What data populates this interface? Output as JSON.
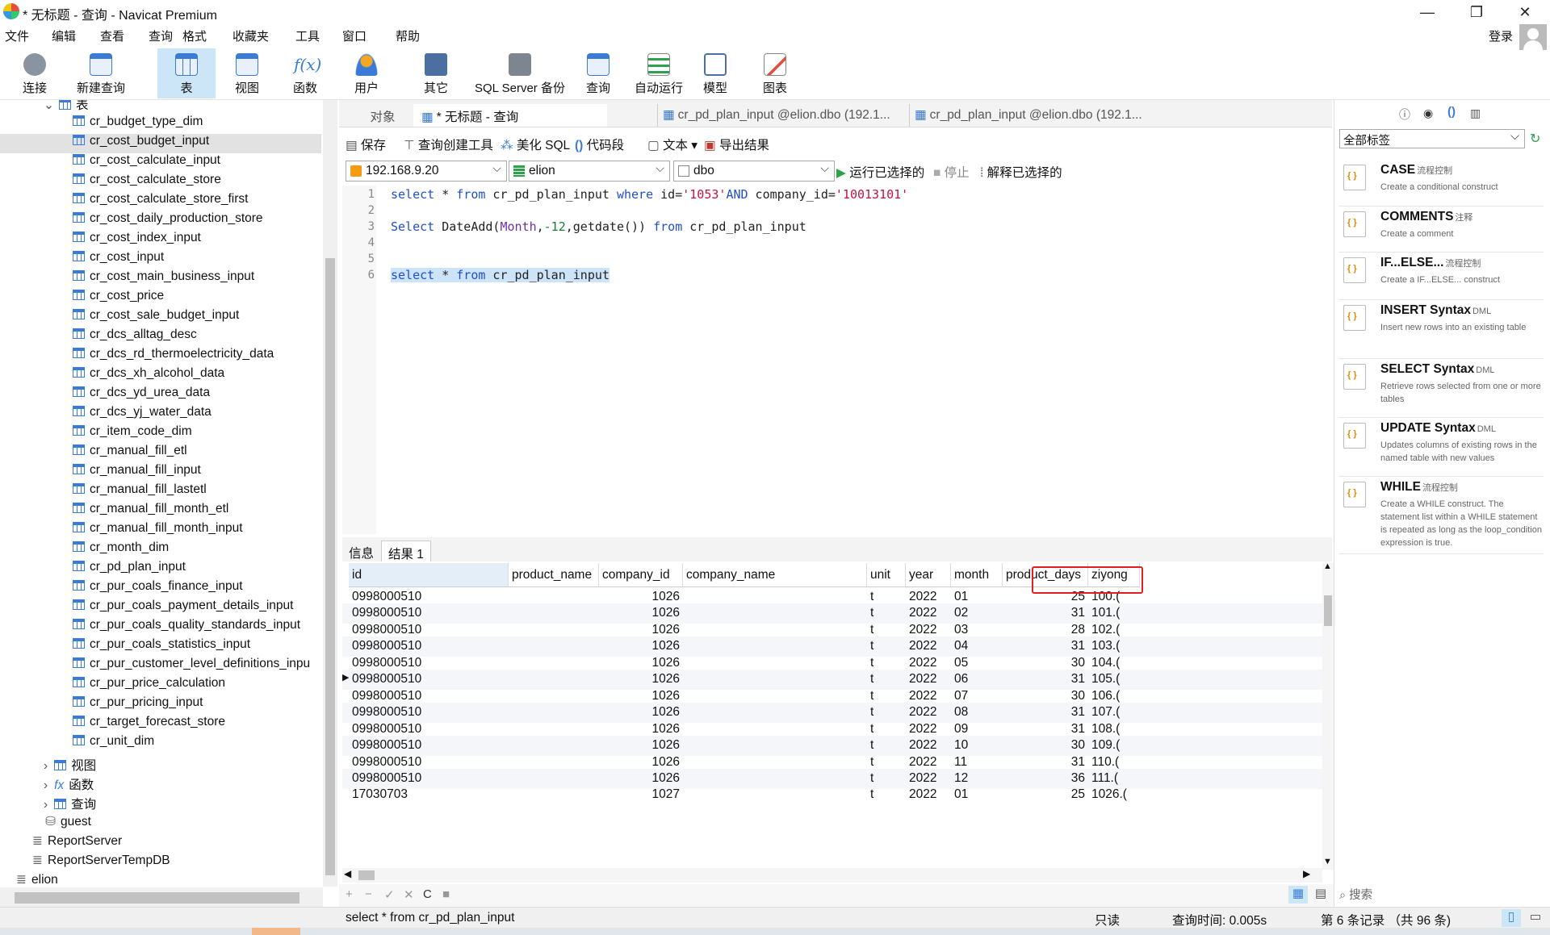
{
  "window": {
    "title": "* 无标题 - 查询 - Navicat Premium"
  },
  "menu": [
    "文件",
    "编辑",
    "查看",
    "查询",
    "格式",
    "收藏夹",
    "工具",
    "窗口",
    "帮助"
  ],
  "login_label": "登录",
  "toolbar": [
    {
      "label": "连接",
      "icon": "connect-icon"
    },
    {
      "label": "新建查询",
      "icon": "new-query-icon"
    },
    {
      "label": "表",
      "icon": "table-icon",
      "active": true
    },
    {
      "label": "视图",
      "icon": "view-icon"
    },
    {
      "label": "函数",
      "icon": "function-icon"
    },
    {
      "label": "用户",
      "icon": "user-icon"
    },
    {
      "label": "其它",
      "icon": "tools-icon"
    },
    {
      "label": "SQL Server 备份",
      "icon": "backup-icon"
    },
    {
      "label": "查询",
      "icon": "query-icon"
    },
    {
      "label": "自动运行",
      "icon": "schedule-icon"
    },
    {
      "label": "模型",
      "icon": "model-icon"
    },
    {
      "label": "图表",
      "icon": "chart-icon"
    }
  ],
  "tree": {
    "tables_label": "表",
    "tables": [
      "cr_budget_type_dim",
      "cr_cost_budget_input",
      "cr_cost_calculate_input",
      "cr_cost_calculate_store",
      "cr_cost_calculate_store_first",
      "cr_cost_daily_production_store",
      "cr_cost_index_input",
      "cr_cost_input",
      "cr_cost_main_business_input",
      "cr_cost_price",
      "cr_cost_sale_budget_input",
      "cr_dcs_alltag_desc",
      "cr_dcs_rd_thermoelectricity_data",
      "cr_dcs_xh_alcohol_data",
      "cr_dcs_yd_urea_data",
      "cr_dcs_yj_water_data",
      "cr_item_code_dim",
      "cr_manual_fill_etl",
      "cr_manual_fill_input",
      "cr_manual_fill_lastetl",
      "cr_manual_fill_month_etl",
      "cr_manual_fill_month_input",
      "cr_month_dim",
      "cr_pd_plan_input",
      "cr_pur_coals_finance_input",
      "cr_pur_coals_payment_details_input",
      "cr_pur_coals_quality_standards_input",
      "cr_pur_coals_statistics_input",
      "cr_pur_customer_level_definitions_inpu",
      "cr_pur_price_calculation",
      "cr_pur_pricing_input",
      "cr_target_forecast_store",
      "cr_unit_dim"
    ],
    "selected_index": 1,
    "groups": [
      "视图",
      "函数",
      "查询"
    ],
    "schema": "guest",
    "databases": [
      "ReportServer",
      "ReportServerTempDB",
      "elion"
    ]
  },
  "tabs": {
    "object": "对象",
    "query": "* 无标题 - 查询",
    "table1": "cr_pd_plan_input @elion.dbo (192.1...",
    "table2": "cr_pd_plan_input @elion.dbo (192.1..."
  },
  "query_tools": {
    "save": "保存",
    "builder": "查询创建工具",
    "beautify": "美化 SQL",
    "snippet": "代码段",
    "text": "文本",
    "export": "导出结果"
  },
  "connection": {
    "server": "192.168.9.20",
    "database": "elion",
    "schema": "dbo",
    "run_selected": "运行已选择的",
    "stop": "停止",
    "explain": "解释已选择的"
  },
  "editor": {
    "line_numbers": [
      "1",
      "2",
      "3",
      "4",
      "5",
      "6"
    ],
    "lines": [
      [
        [
          "kw",
          "select"
        ],
        [
          "t",
          " * "
        ],
        [
          "kw",
          "from"
        ],
        [
          "t",
          " cr_pd_plan_input "
        ],
        [
          "kw",
          "where"
        ],
        [
          "t",
          " id="
        ],
        [
          "str",
          "'1053'"
        ],
        [
          "kw",
          "AND"
        ],
        [
          "t",
          " company_id="
        ],
        [
          "str",
          "'10013101'"
        ]
      ],
      [],
      [
        [
          "kw",
          "Select"
        ],
        [
          "t",
          " DateAdd("
        ],
        [
          "fn",
          "Month"
        ],
        [
          "t",
          ","
        ],
        [
          "num",
          "-12"
        ],
        [
          "t",
          ",getdate()) "
        ],
        [
          "kw",
          "from"
        ],
        [
          "t",
          " cr_pd_plan_input"
        ]
      ],
      [],
      [],
      [
        [
          "kw",
          "select"
        ],
        [
          "t",
          " * "
        ],
        [
          "kw",
          "from"
        ],
        [
          "t",
          " cr_pd_plan_input"
        ]
      ]
    ]
  },
  "result_tabs": [
    "信息",
    "结果 1"
  ],
  "grid": {
    "columns": [
      "id",
      "product_name",
      "company_id",
      "company_name",
      "unit",
      "year",
      "month",
      "product_days",
      "ziyong"
    ],
    "rows": [
      [
        "0998000510",
        "",
        "1026",
        "",
        "t",
        "2022",
        "01",
        "25",
        "100.("
      ],
      [
        "0998000510",
        "",
        "1026",
        "",
        "t",
        "2022",
        "02",
        "31",
        "101.("
      ],
      [
        "0998000510",
        "",
        "1026",
        "",
        "t",
        "2022",
        "03",
        "28",
        "102.("
      ],
      [
        "0998000510",
        "",
        "1026",
        "",
        "t",
        "2022",
        "04",
        "31",
        "103.("
      ],
      [
        "0998000510",
        "",
        "1026",
        "",
        "t",
        "2022",
        "05",
        "30",
        "104.("
      ],
      [
        "0998000510",
        "",
        "1026",
        "",
        "t",
        "2022",
        "06",
        "31",
        "105.("
      ],
      [
        "0998000510",
        "",
        "1026",
        "",
        "t",
        "2022",
        "07",
        "30",
        "106.("
      ],
      [
        "0998000510",
        "",
        "1026",
        "",
        "t",
        "2022",
        "08",
        "31",
        "107.("
      ],
      [
        "0998000510",
        "",
        "1026",
        "",
        "t",
        "2022",
        "09",
        "31",
        "108.("
      ],
      [
        "0998000510",
        "",
        "1026",
        "",
        "t",
        "2022",
        "10",
        "30",
        "109.("
      ],
      [
        "0998000510",
        "",
        "1026",
        "",
        "t",
        "2022",
        "11",
        "31",
        "110.("
      ],
      [
        "0998000510",
        "",
        "1026",
        "",
        "t",
        "2022",
        "12",
        "36",
        "111.("
      ],
      [
        "17030703",
        "",
        "1027",
        "",
        "t",
        "2022",
        "01",
        "25",
        "1026.("
      ]
    ],
    "current_row": 5
  },
  "grid_footer": [
    "+",
    "−",
    "✓",
    "✕",
    "C",
    "■"
  ],
  "right_panel": {
    "filter": "全部标签",
    "search_placeholder": "搜索",
    "snippets": [
      {
        "title": "CASE",
        "tag": "流程控制",
        "desc": "Create a conditional construct"
      },
      {
        "title": "COMMENTS",
        "tag": "注释",
        "desc": "Create a comment"
      },
      {
        "title": "IF...ELSE...",
        "tag": "流程控制",
        "desc": "Create a IF...ELSE... construct"
      },
      {
        "title": "INSERT Syntax",
        "tag": "DML",
        "desc": "Insert new rows into an existing table"
      },
      {
        "title": "SELECT Syntax",
        "tag": "DML",
        "desc": "Retrieve rows selected from one or more tables"
      },
      {
        "title": "UPDATE Syntax",
        "tag": "DML",
        "desc": "Updates columns of existing rows in the named table with new values"
      },
      {
        "title": "WHILE",
        "tag": "流程控制",
        "desc": "Create a WHILE construct. The statement list within a WHILE statement is repeated as long as the loop_condition expression is true."
      }
    ]
  },
  "status": {
    "sql": "select * from cr_pd_plan_input",
    "readonly": "只读",
    "query_time": "查询时间: 0.005s",
    "record": "第 6 条记录 （共 96 条)"
  }
}
